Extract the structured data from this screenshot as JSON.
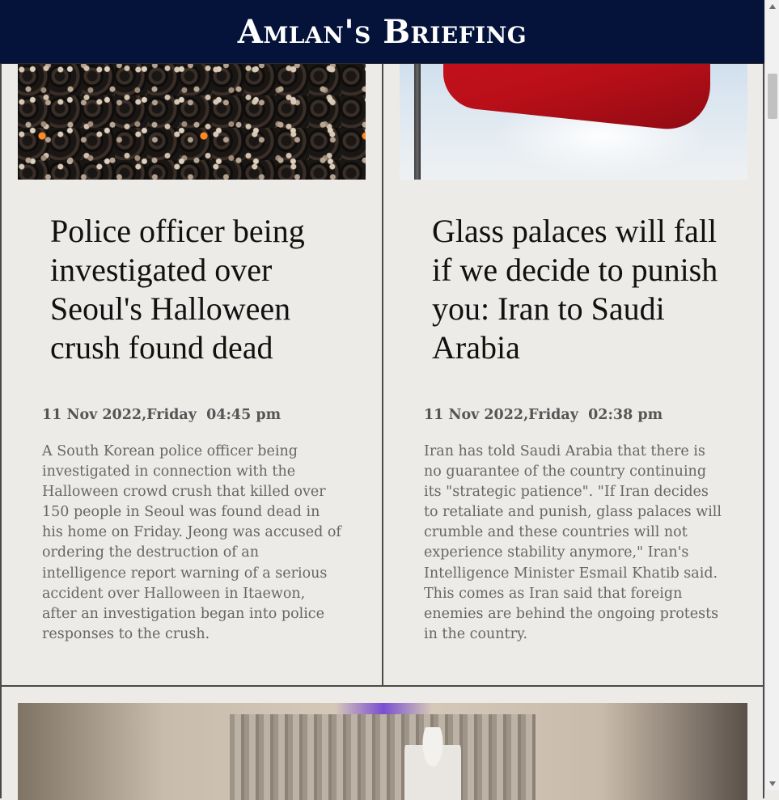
{
  "header": {
    "brand": "Amlan's Briefing"
  },
  "articles": [
    {
      "image_alt": "crowd-photo",
      "headline": "Police officer being investigated over Seoul's Halloween crush found dead",
      "date": "11 Nov 2022,Friday  04:45 pm",
      "summary": "A South Korean police officer being investigated in connection with the Halloween crowd crush that killed over 150 people in Seoul was found dead in his home on Friday. Jeong was accused of ordering the destruction of an intelligence report warning of a serious accident over Halloween in Itaewon, after an investigation began into police responses to the crush."
    },
    {
      "image_alt": "flag-photo",
      "headline": "Glass palaces will fall if we decide to punish you: Iran to Saudi Arabia",
      "date": "11 Nov 2022,Friday  02:38 pm",
      "summary": "Iran has told Saudi Arabia that there is no guarantee of the country continuing its \"strategic patience\". \"If Iran decides to retaliate and punish, glass palaces will crumble and these countries will not experience stability anymore,\" Iran's Intelligence Minister Esmail Khatib said. This comes as Iran said that foreign enemies are behind the ongoing protests in the country."
    }
  ],
  "scrollbar": {
    "up_icon": "arrow-up-icon",
    "down_icon": "arrow-down-icon"
  }
}
